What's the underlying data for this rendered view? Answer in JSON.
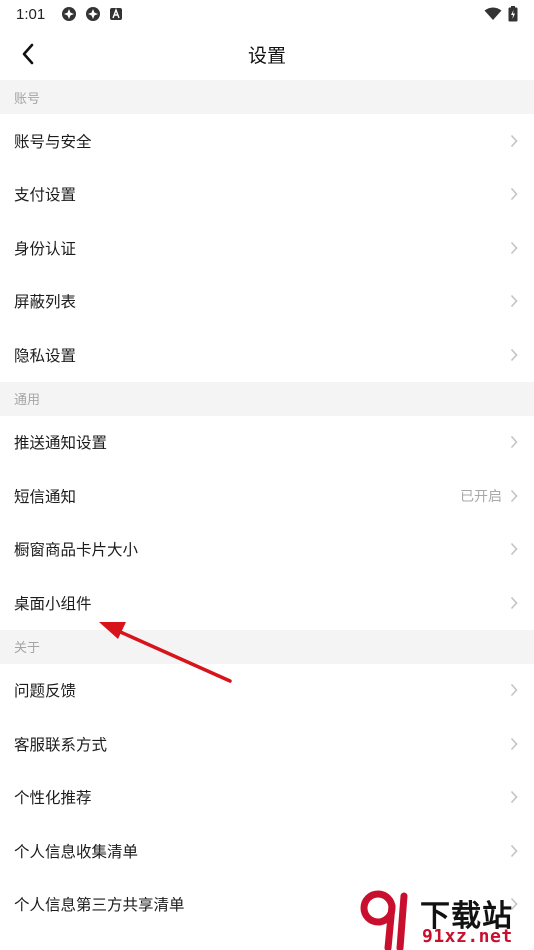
{
  "status_bar": {
    "time": "1:01",
    "left_icons": [
      "app-icon-1",
      "app-icon-2",
      "notification-a-icon"
    ],
    "right_icons": [
      "wifi-icon",
      "battery-icon"
    ]
  },
  "nav": {
    "title": "设置",
    "back_icon": "chevron-left-icon"
  },
  "sections": [
    {
      "header": "账号",
      "items": [
        {
          "label": "账号与安全"
        },
        {
          "label": "支付设置"
        },
        {
          "label": "身份认证"
        },
        {
          "label": "屏蔽列表"
        },
        {
          "label": "隐私设置"
        }
      ]
    },
    {
      "header": "通用",
      "items": [
        {
          "label": "推送通知设置"
        },
        {
          "label": "短信通知",
          "value": "已开启"
        },
        {
          "label": "橱窗商品卡片大小"
        },
        {
          "label": "桌面小组件"
        }
      ]
    },
    {
      "header": "关于",
      "items": [
        {
          "label": "问题反馈"
        },
        {
          "label": "客服联系方式"
        },
        {
          "label": "个性化推荐"
        },
        {
          "label": "个人信息收集清单"
        },
        {
          "label": "个人信息第三方共享清单"
        }
      ]
    }
  ],
  "annotation": {
    "arrow_color": "#d8141b"
  },
  "watermark": {
    "logo": "91",
    "text_top": "下载站",
    "text_bottom": "91xz.net",
    "accent_color": "#c8102e"
  }
}
